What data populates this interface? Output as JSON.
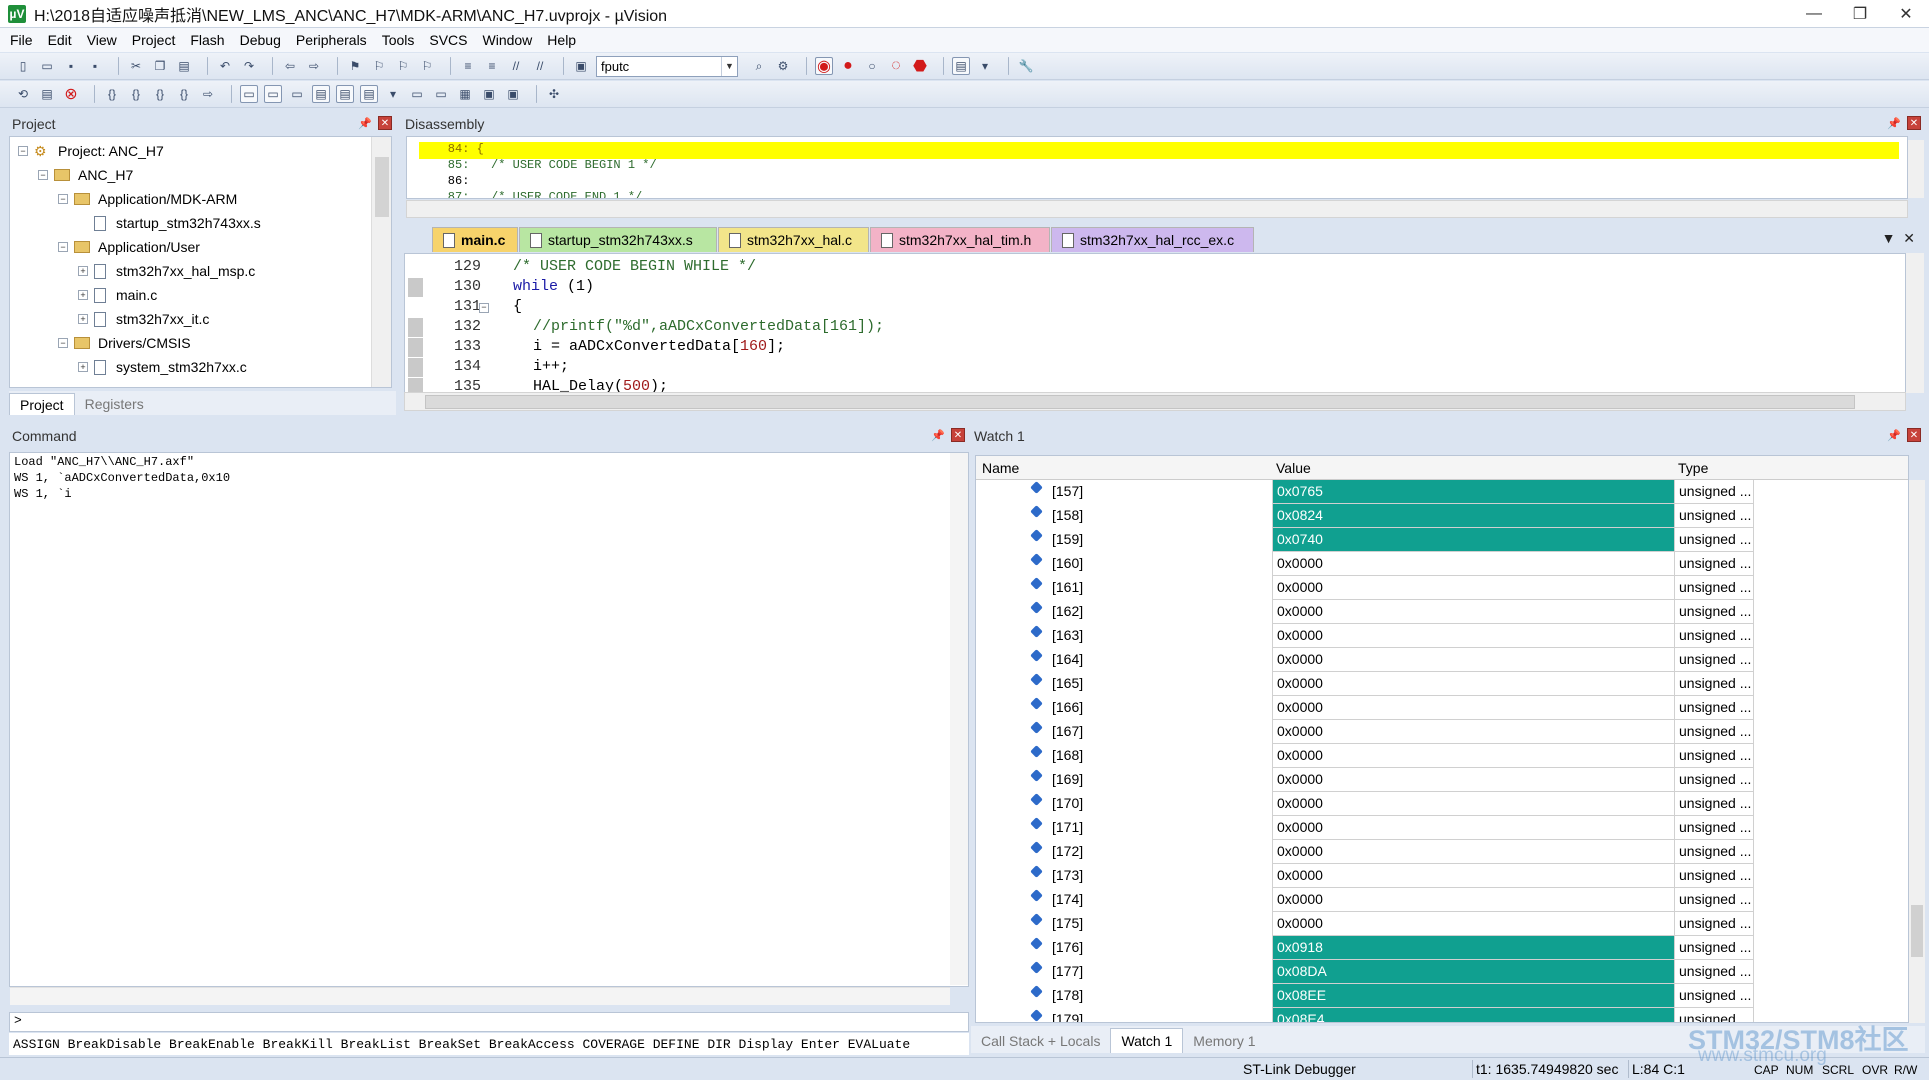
{
  "window": {
    "title": "H:\\2018自适应噪声抵消\\NEW_LMS_ANC\\ANC_H7\\MDK-ARM\\ANC_H7.uvprojx - µVision",
    "app_icon": "µV",
    "controls": [
      "—",
      "❐",
      "✕"
    ]
  },
  "menu": [
    "File",
    "Edit",
    "View",
    "Project",
    "Flash",
    "Debug",
    "Peripherals",
    "Tools",
    "SVCS",
    "Window",
    "Help"
  ],
  "toolbar": {
    "find_combo_value": "fputc"
  },
  "project_panel": {
    "title": "Project",
    "items": [
      {
        "label": "Project: ANC_H7",
        "kind": "project"
      },
      {
        "label": "ANC_H7",
        "kind": "target"
      },
      {
        "label": "Application/MDK-ARM",
        "kind": "folder"
      },
      {
        "label": "startup_stm32h743xx.s",
        "kind": "file"
      },
      {
        "label": "Application/User",
        "kind": "folder"
      },
      {
        "label": "stm32h7xx_hal_msp.c",
        "kind": "file"
      },
      {
        "label": "main.c",
        "kind": "file"
      },
      {
        "label": "stm32h7xx_it.c",
        "kind": "file"
      },
      {
        "label": "Drivers/CMSIS",
        "kind": "folder"
      },
      {
        "label": "system_stm32h7xx.c",
        "kind": "file"
      }
    ],
    "tabs": [
      "Project",
      "Registers"
    ]
  },
  "disassembly": {
    "title": "Disassembly",
    "lines": [
      "    84: {",
      "    85:   /* USER CODE BEGIN 1 */",
      "    86: ",
      "    87:   /* USER CODE END 1 */"
    ]
  },
  "editor": {
    "tabs": [
      {
        "label": "main.c",
        "color": "#f7d36b"
      },
      {
        "label": "startup_stm32h743xx.s",
        "color": "#b8e6a2"
      },
      {
        "label": "stm32h7xx_hal.c",
        "color": "#f2e58a"
      },
      {
        "label": "stm32h7xx_hal_tim.h",
        "color": "#f3b3c7"
      },
      {
        "label": "stm32h7xx_hal_rcc_ex.c",
        "color": "#cdb8ee"
      }
    ],
    "line_numbers": [
      "129",
      "130",
      "131",
      "132",
      "133",
      "134",
      "135"
    ],
    "code": {
      "l129": "/* USER CODE BEGIN WHILE */",
      "l130_kw": "while",
      "l130_rest": " (1)",
      "l131": "{",
      "l132": "//printf(\"%d\",aADCxConvertedData[161]);",
      "l133_a": "i = aADCxConvertedData[",
      "l133_num": "160",
      "l133_b": "];",
      "l134": "i++;",
      "l135_a": "HAL_Delay(",
      "l135_num": "500",
      "l135_b": ");"
    }
  },
  "command": {
    "title": "Command",
    "output": [
      "Load \"ANC_H7\\\\ANC_H7.axf\"",
      "WS 1, `aADCxConvertedData,0x10",
      "WS 1, `i"
    ],
    "prompt": ">",
    "help": "ASSIGN BreakDisable BreakEnable BreakKill BreakList BreakSet BreakAccess COVERAGE DEFINE DIR Display Enter EVALuate"
  },
  "watch": {
    "title": "Watch 1",
    "columns": [
      "Name",
      "Value",
      "Type"
    ],
    "rows": [
      {
        "name": "[157]",
        "value": "0x0765",
        "type": "unsigned ...",
        "changed": true
      },
      {
        "name": "[158]",
        "value": "0x0824",
        "type": "unsigned ...",
        "changed": true
      },
      {
        "name": "[159]",
        "value": "0x0740",
        "type": "unsigned ...",
        "changed": true
      },
      {
        "name": "[160]",
        "value": "0x0000",
        "type": "unsigned ...",
        "changed": false
      },
      {
        "name": "[161]",
        "value": "0x0000",
        "type": "unsigned ...",
        "changed": false
      },
      {
        "name": "[162]",
        "value": "0x0000",
        "type": "unsigned ...",
        "changed": false
      },
      {
        "name": "[163]",
        "value": "0x0000",
        "type": "unsigned ...",
        "changed": false
      },
      {
        "name": "[164]",
        "value": "0x0000",
        "type": "unsigned ...",
        "changed": false
      },
      {
        "name": "[165]",
        "value": "0x0000",
        "type": "unsigned ...",
        "changed": false
      },
      {
        "name": "[166]",
        "value": "0x0000",
        "type": "unsigned ...",
        "changed": false
      },
      {
        "name": "[167]",
        "value": "0x0000",
        "type": "unsigned ...",
        "changed": false
      },
      {
        "name": "[168]",
        "value": "0x0000",
        "type": "unsigned ...",
        "changed": false
      },
      {
        "name": "[169]",
        "value": "0x0000",
        "type": "unsigned ...",
        "changed": false
      },
      {
        "name": "[170]",
        "value": "0x0000",
        "type": "unsigned ...",
        "changed": false
      },
      {
        "name": "[171]",
        "value": "0x0000",
        "type": "unsigned ...",
        "changed": false
      },
      {
        "name": "[172]",
        "value": "0x0000",
        "type": "unsigned ...",
        "changed": false
      },
      {
        "name": "[173]",
        "value": "0x0000",
        "type": "unsigned ...",
        "changed": false
      },
      {
        "name": "[174]",
        "value": "0x0000",
        "type": "unsigned ...",
        "changed": false
      },
      {
        "name": "[175]",
        "value": "0x0000",
        "type": "unsigned ...",
        "changed": false
      },
      {
        "name": "[176]",
        "value": "0x0918",
        "type": "unsigned ...",
        "changed": true
      },
      {
        "name": "[177]",
        "value": "0x08DA",
        "type": "unsigned ...",
        "changed": true
      },
      {
        "name": "[178]",
        "value": "0x08EE",
        "type": "unsigned ...",
        "changed": true
      },
      {
        "name": "[179]",
        "value": "0x08E4",
        "type": "unsigned ...",
        "changed": true
      }
    ],
    "tabs": [
      "Call Stack + Locals",
      "Watch 1",
      "Memory 1"
    ]
  },
  "status": {
    "debugger": "ST-Link Debugger",
    "time": "t1: 1635.74949820 sec",
    "cursor": "L:84 C:1",
    "indicators": [
      "CAP",
      "NUM",
      "SCRL",
      "OVR",
      "R/W"
    ]
  },
  "watermark": {
    "line1": "STM32/STM8社区",
    "line2": "www.stmcu.org"
  },
  "colors": {
    "changed_value_bg": "#10a090",
    "current_line": "#ffff00"
  }
}
